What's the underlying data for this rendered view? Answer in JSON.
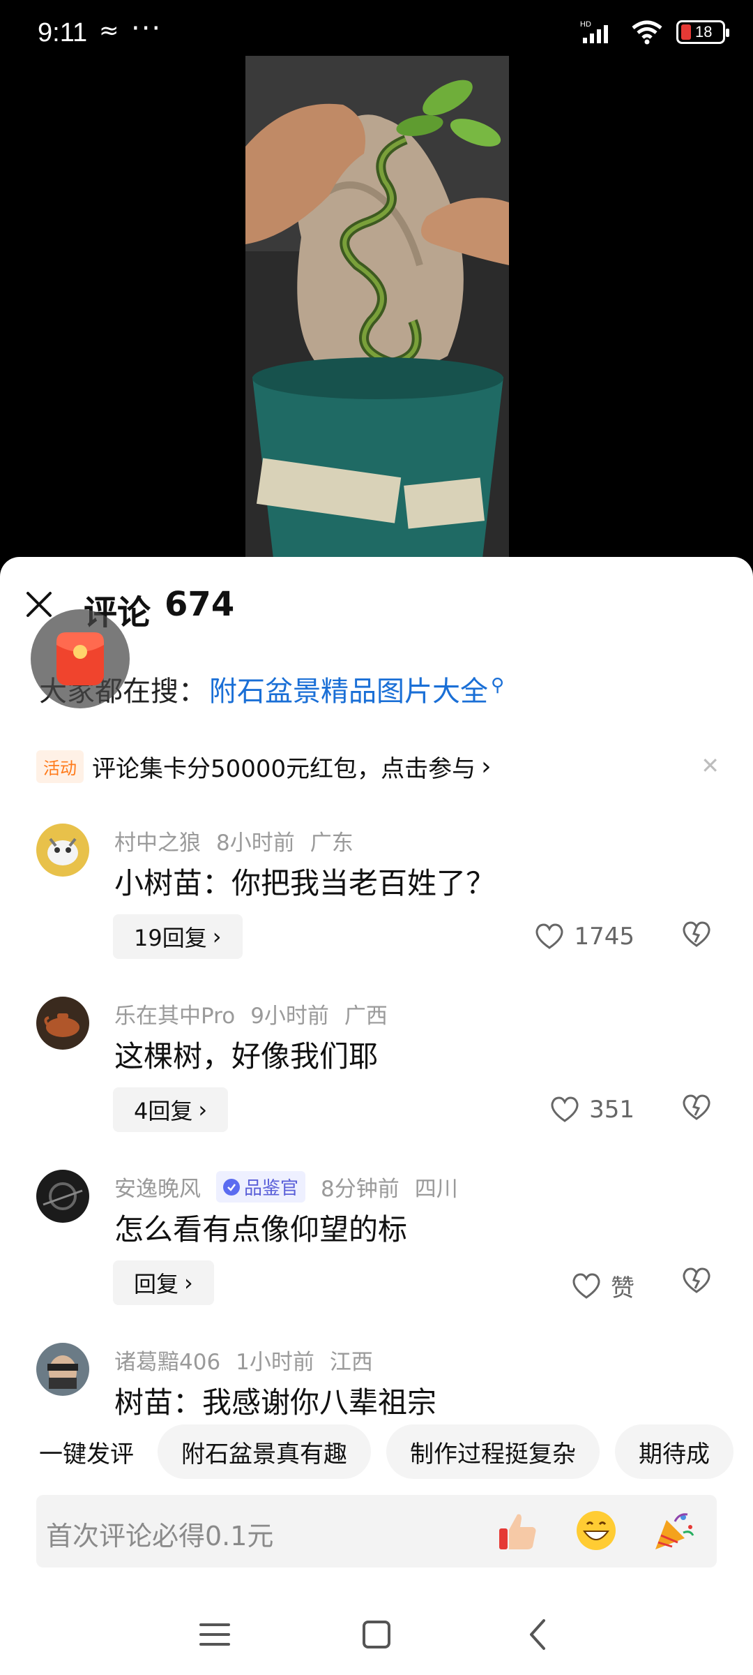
{
  "status_bar": {
    "time": "9:11",
    "extra_icon": "≈",
    "dots": "···",
    "battery": "18",
    "signal_label": "HD"
  },
  "comments_sheet": {
    "title": "评论",
    "count": "674",
    "search_hint_prefix": "大家都在搜：",
    "search_hint_link": "附石盆景精品图片大全",
    "activity": {
      "badge": "活动",
      "text": "评论集卡分50000元红包，点击参与",
      "chevron": "›"
    },
    "comments": [
      {
        "user": "村中之狼",
        "time": "8小时前",
        "location": "广东",
        "text": "小树苗：你把我当老百姓了？",
        "replies": "19回复",
        "likes": "1745"
      },
      {
        "user": "乐在其中Pro",
        "time": "9小时前",
        "location": "广西",
        "text": "这棵树，好像我们耶",
        "replies": "4回复",
        "likes": "351"
      },
      {
        "user": "安逸晚风",
        "badge": "品鉴官",
        "time": "8分钟前",
        "location": "四川",
        "text": "怎么看有点像仰望的标",
        "replies": "回复",
        "likes": "赞"
      },
      {
        "user": "诸葛黯406",
        "time": "1小时前",
        "location": "江西",
        "text": "树苗：我感谢你八辈祖宗"
      }
    ],
    "quick_comments": {
      "label": "一键发评",
      "chips": [
        "附石盆景真有趣",
        "制作过程挺复杂",
        "期待成"
      ]
    },
    "input": {
      "placeholder": "首次评论必得0.1元"
    }
  },
  "colors": {
    "link_blue": "#1a6fd6",
    "activity_orange": "#ff7a1a",
    "battery_red": "#e53935"
  }
}
